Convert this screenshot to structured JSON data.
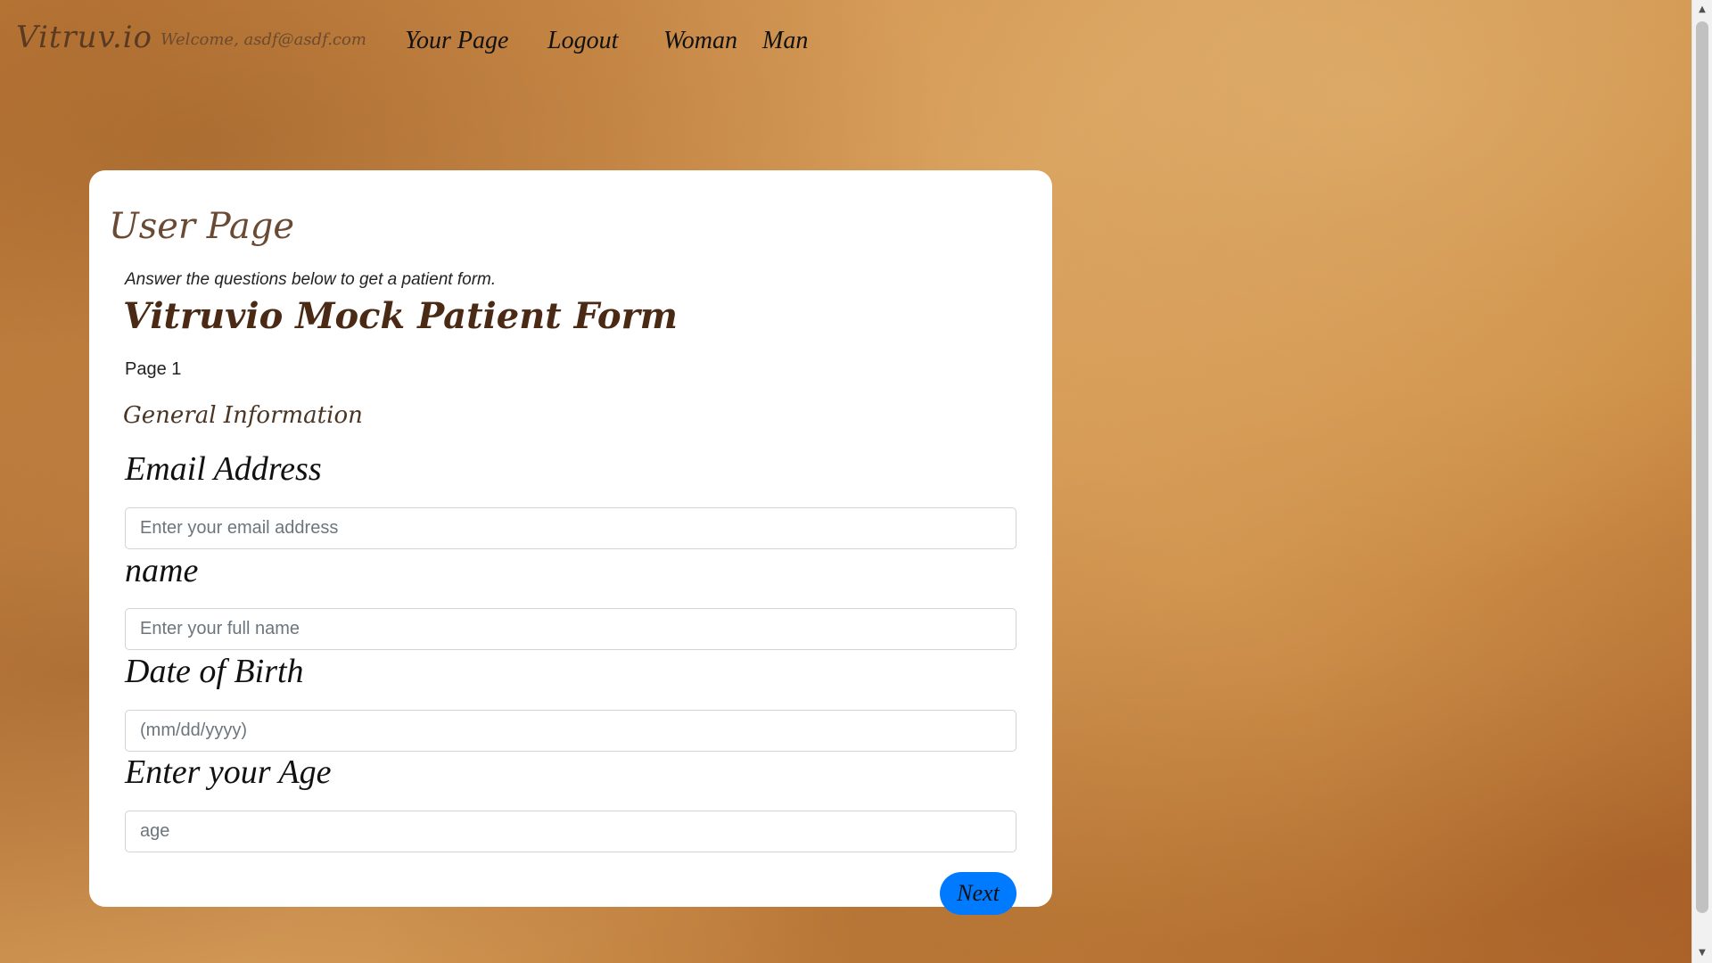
{
  "navbar": {
    "brand": "Vitruv.io",
    "welcome": "Welcome, asdf@asdf.com",
    "links": [
      {
        "label": "Your Page"
      },
      {
        "label": "Logout"
      },
      {
        "label": "Woman"
      },
      {
        "label": "Man"
      }
    ]
  },
  "card": {
    "title": "User Page",
    "instructions": "Answer the questions below to get a patient form.",
    "form_title": "Vitruvio Mock Patient Form",
    "page_number": "Page 1",
    "section_title": "General Information",
    "fields": [
      {
        "label": "Email Address",
        "placeholder": "Enter your email address",
        "value": ""
      },
      {
        "label": "name",
        "placeholder": "Enter your full name",
        "value": ""
      },
      {
        "label": "Date of Birth",
        "placeholder": "(mm/dd/yyyy)",
        "value": ""
      },
      {
        "label": "Enter your Age",
        "placeholder": "age",
        "value": ""
      }
    ],
    "next_label": "Next"
  },
  "colors": {
    "background": "#c98a45",
    "card": "#ffffff",
    "primary_button": "#007bff",
    "title_brown": "#4a2a14"
  },
  "icons": {
    "scroll_up": "scroll-up-arrow-icon",
    "scroll_down": "scroll-down-arrow-icon"
  }
}
